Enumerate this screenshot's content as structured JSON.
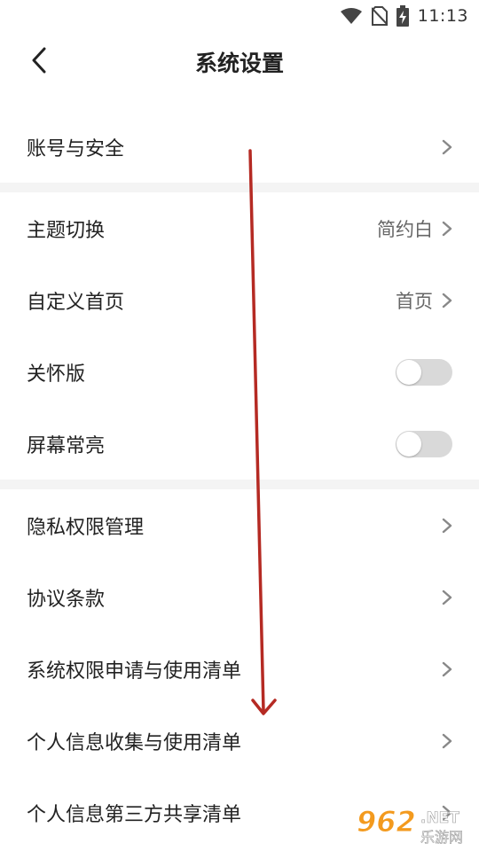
{
  "status_bar": {
    "time": "11:13",
    "icons": [
      "wifi-icon",
      "no-sim-icon",
      "battery-charging-icon"
    ]
  },
  "header": {
    "title": "系统设置",
    "back_icon": "chevron-left-icon"
  },
  "sections": [
    {
      "items": [
        {
          "label": "账号与安全",
          "type": "link"
        }
      ]
    },
    {
      "items": [
        {
          "label": "主题切换",
          "value": "简约白",
          "type": "link"
        },
        {
          "label": "自定义首页",
          "value": "首页",
          "type": "link"
        },
        {
          "label": "关怀版",
          "type": "toggle",
          "on": false
        },
        {
          "label": "屏幕常亮",
          "type": "toggle",
          "on": false
        }
      ]
    },
    {
      "items": [
        {
          "label": "隐私权限管理",
          "type": "link"
        },
        {
          "label": "协议条款",
          "type": "link"
        },
        {
          "label": "系统权限申请与使用清单",
          "type": "link"
        },
        {
          "label": "个人信息收集与使用清单",
          "type": "link"
        },
        {
          "label": "个人信息第三方共享清单",
          "type": "link"
        }
      ]
    }
  ],
  "watermark": {
    "number": "962",
    "suffix": ".NET",
    "name": "乐游网"
  },
  "colors": {
    "annotation_arrow": "#b52a23",
    "toggle_off": "#d9d9d9",
    "section_gap": "#f4f4f4",
    "watermark_orange": "#f39a1e"
  }
}
